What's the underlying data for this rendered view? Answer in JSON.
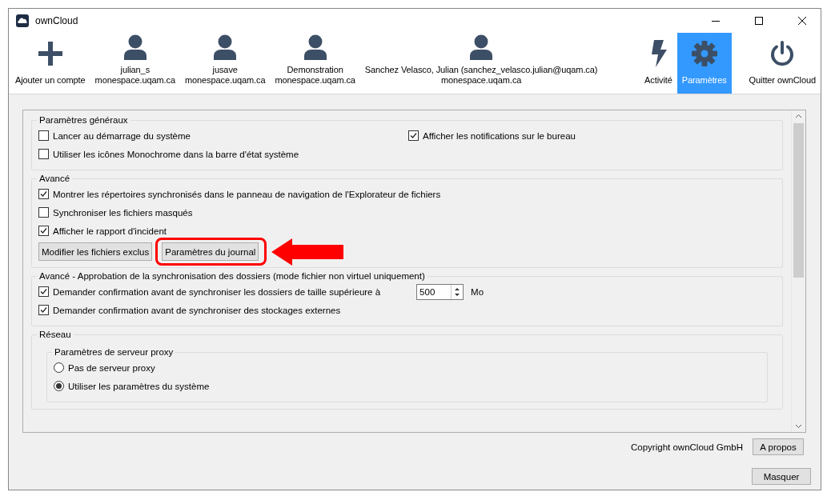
{
  "window": {
    "title": "ownCloud"
  },
  "toolbar": [
    {
      "kind": "add",
      "label": "Ajouter un compte",
      "selected": false
    },
    {
      "kind": "account",
      "label": "julian_s",
      "sublabel": "monespace.uqam.ca",
      "selected": false
    },
    {
      "kind": "account",
      "label": "jusave",
      "sublabel": "monespace.uqam.ca",
      "selected": false
    },
    {
      "kind": "account",
      "label": "Demonstration",
      "sublabel": "monespace.uqam.ca",
      "selected": false
    },
    {
      "kind": "account",
      "label": "Sanchez Velasco, Julian (sanchez_velasco.julian@uqam.ca)",
      "sublabel": "monespace.uqam.ca",
      "selected": false
    },
    {
      "kind": "activity",
      "label": "Activité",
      "selected": false
    },
    {
      "kind": "settings",
      "label": "Paramètres",
      "selected": true
    },
    {
      "kind": "quit",
      "label": "Quitter ownCloud",
      "selected": false
    }
  ],
  "general": {
    "title": "Paramètres généraux",
    "left": [
      {
        "label": "Lancer au démarrage du système",
        "checked": false
      },
      {
        "label": "Utiliser les icônes Monochrome dans la barre d'état système",
        "checked": false
      }
    ],
    "right": [
      {
        "label": "Afficher les notifications sur le bureau",
        "checked": true
      }
    ]
  },
  "advanced": {
    "title": "Avancé",
    "options": [
      {
        "label": "Montrer les répertoires synchronisés dans le panneau de navigation de l'Explorateur de fichiers",
        "checked": true
      },
      {
        "label": "Synchroniser les fichiers masqués",
        "checked": false
      },
      {
        "label": "Afficher le rapport d'incident",
        "checked": true
      }
    ],
    "buttons": [
      {
        "label": "Modifier les fichiers exclus",
        "highlighted": false
      },
      {
        "label": "Paramètres du journal",
        "highlighted": true
      }
    ]
  },
  "approval": {
    "title": "Avancé - Approbation de la synchronisation des dossiers (mode fichier non virtuel uniquement)",
    "options": [
      {
        "kind": "size",
        "label": "Demander confirmation avant de synchroniser les dossiers de taille supérieure à",
        "checked": true,
        "value": "500",
        "unit": "Mo"
      },
      {
        "kind": "plain",
        "label": "Demander confirmation avant de synchroniser des stockages externes",
        "checked": true
      }
    ]
  },
  "network": {
    "title": "Réseau",
    "proxy": {
      "title": "Paramètres de serveur proxy",
      "options": [
        {
          "label": "Pas de serveur proxy",
          "selected": false
        },
        {
          "label": "Utiliser les paramètres du système",
          "selected": true
        }
      ]
    }
  },
  "footer": {
    "copyright": "Copyright ownCloud GmbH",
    "about_button": "A propos",
    "hide_button": "Masquer"
  }
}
